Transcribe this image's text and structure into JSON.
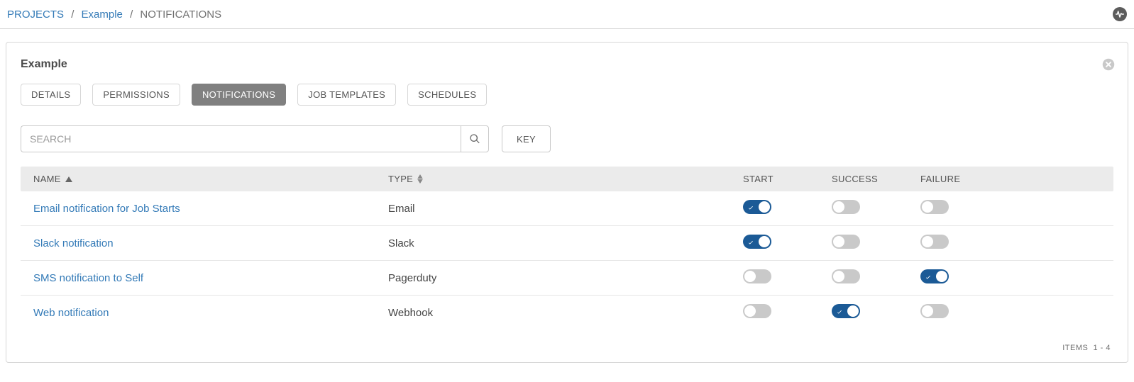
{
  "breadcrumb": {
    "projects": "PROJECTS",
    "project_name": "Example",
    "current": "NOTIFICATIONS"
  },
  "card": {
    "title": "Example"
  },
  "tabs": [
    {
      "label": "DETAILS",
      "active": false
    },
    {
      "label": "PERMISSIONS",
      "active": false
    },
    {
      "label": "NOTIFICATIONS",
      "active": true
    },
    {
      "label": "JOB TEMPLATES",
      "active": false
    },
    {
      "label": "SCHEDULES",
      "active": false
    }
  ],
  "search": {
    "placeholder": "SEARCH",
    "value": ""
  },
  "key_button": "KEY",
  "columns": {
    "name": "NAME",
    "type": "TYPE",
    "start": "START",
    "success": "SUCCESS",
    "failure": "FAILURE"
  },
  "rows": [
    {
      "name": "Email notification for Job Starts",
      "type": "Email",
      "start": true,
      "success": false,
      "failure": false
    },
    {
      "name": "Slack notification",
      "type": "Slack",
      "start": true,
      "success": false,
      "failure": false
    },
    {
      "name": "SMS notification to Self",
      "type": "Pagerduty",
      "start": false,
      "success": false,
      "failure": true
    },
    {
      "name": "Web notification",
      "type": "Webhook",
      "start": false,
      "success": true,
      "failure": false
    }
  ],
  "footer": {
    "items_label": "ITEMS",
    "range": "1 - 4"
  }
}
